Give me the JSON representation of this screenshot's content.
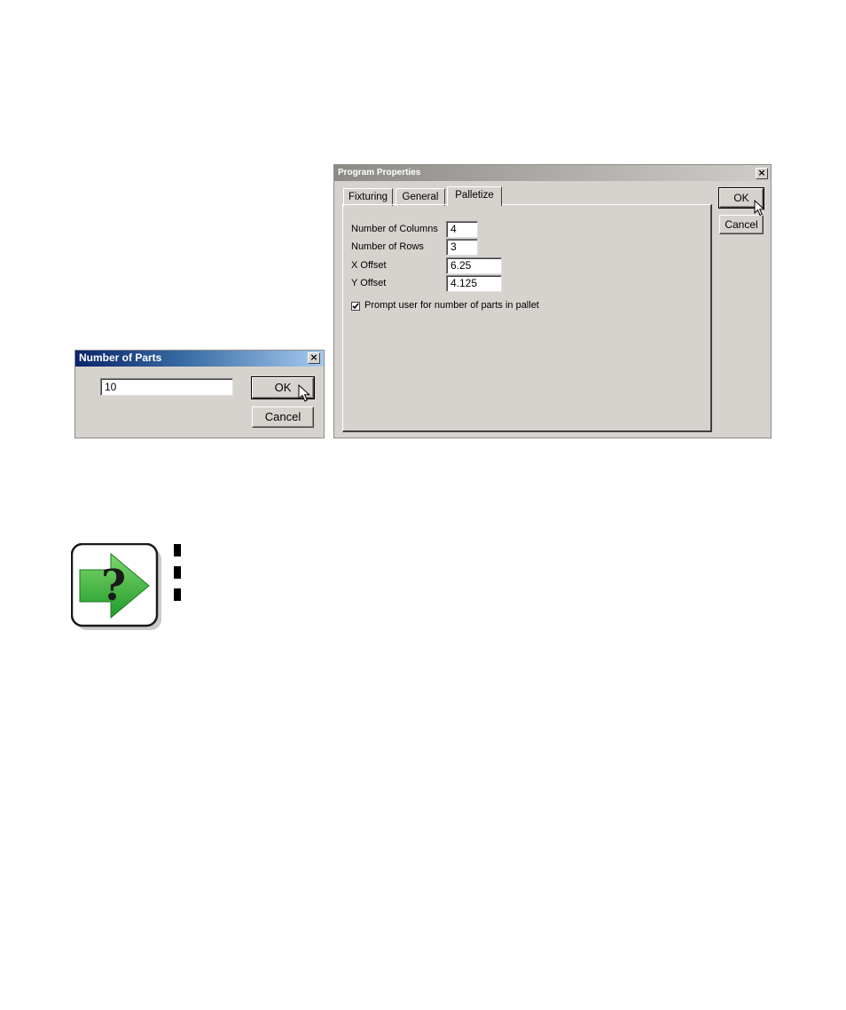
{
  "number_of_parts_dialog": {
    "title": "Number of Parts",
    "close_label": "×",
    "value": "10",
    "ok_label": "OK",
    "cancel_label": "Cancel"
  },
  "program_properties_dialog": {
    "title": "Program Properties",
    "close_label": "×",
    "tabs": [
      {
        "label": "Fixturing"
      },
      {
        "label": "General"
      },
      {
        "label": "Palletize"
      }
    ],
    "active_tab": "Palletize",
    "fields": [
      {
        "label": "Number of Columns",
        "value": "4"
      },
      {
        "label": "Number of Rows",
        "value": "3"
      },
      {
        "label": "X Offset",
        "value": "6.25"
      },
      {
        "label": "Y Offset",
        "value": "4.125"
      }
    ],
    "checkbox": {
      "label": "Prompt user for number of parts in pallet",
      "checked": true
    },
    "ok_label": "OK",
    "cancel_label": "Cancel"
  },
  "note_icon": {
    "glyph": "?"
  },
  "colors": {
    "titlebar_start": "#0a246a",
    "titlebar_end": "#a6caf0",
    "dialog_bg": "#d6d3ce",
    "arrow_green": "#3db53a"
  }
}
